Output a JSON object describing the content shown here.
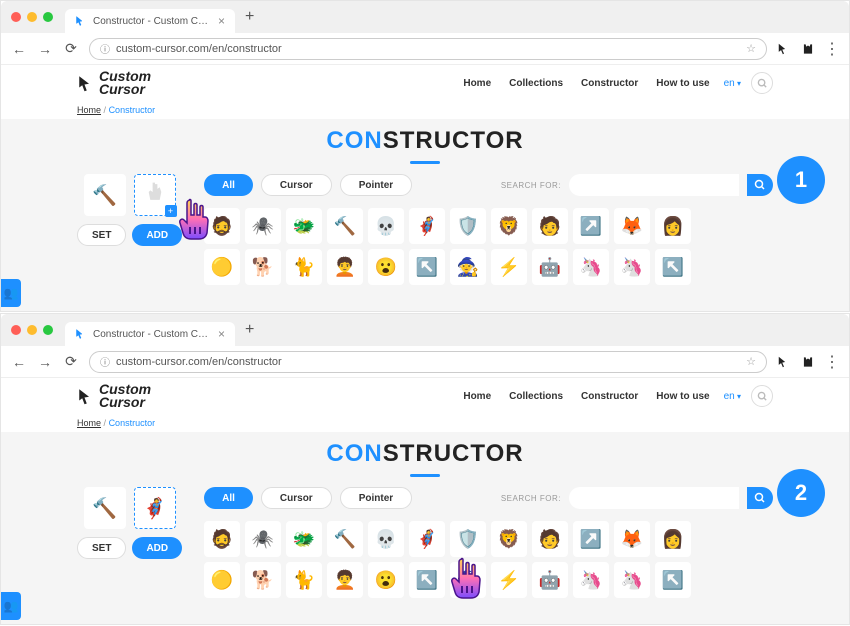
{
  "browser": {
    "tab_title": "Constructor - Custom Cursor br",
    "url": "custom-cursor.com/en/constructor"
  },
  "nav": {
    "home": "Home",
    "collections": "Collections",
    "constructor": "Constructor",
    "how_to_use": "How to use",
    "lang": "en"
  },
  "logo": {
    "top": "Custom",
    "bottom": "Cursor"
  },
  "breadcrumb": {
    "home": "Home",
    "sep": "/",
    "current": "Constructor"
  },
  "title": {
    "blue": "CON",
    "dark": "STRUCTOR"
  },
  "filters": {
    "all": "All",
    "cursor": "Cursor",
    "pointer": "Pointer"
  },
  "search": {
    "label": "SEARCH FOR:"
  },
  "buttons": {
    "set": "SET",
    "add": "ADD"
  },
  "step1": "1",
  "step2": "2",
  "grid_items": [
    "🧔",
    "🕷️",
    "🐲",
    "🔨",
    "💀",
    "🦸",
    "🛡️",
    "🦁",
    "🧑",
    "↗️",
    "🦊",
    "👩",
    "🟡",
    "🐕",
    "🐈",
    "🧑‍🦱",
    "😮",
    "↖️",
    "🧙",
    "⚡",
    "🤖",
    "🦄",
    "🦄",
    "↖️"
  ]
}
